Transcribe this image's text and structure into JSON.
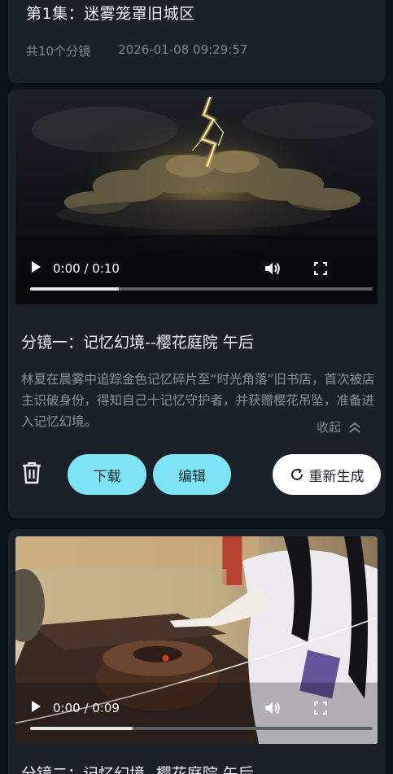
{
  "episode": {
    "title": "第1集：迷雾笼罩旧城区",
    "shot_count": "共10个分镜",
    "datetime": "2026-01-08  09:29:57"
  },
  "shots": [
    {
      "title": "分镜一：记忆幻境--樱花庭院 午后",
      "description": "林夏在晨雾中追踪金色记忆碎片至“时光角落”旧书店，首次被店主识破身份，得知自己十记忆守护者，并获赠樱花吊坠，准备进入记忆幻境。",
      "collapse_label": "收起",
      "video": {
        "time": "0:00 / 0:10",
        "progress": 0.26
      },
      "buttons": {
        "download": "下载",
        "edit": "编辑",
        "regenerate": "重新生成"
      }
    },
    {
      "title": "分镜二：记忆幻境--樱花庭院 午后",
      "video": {
        "time": "0:00 / 0:09",
        "progress": 0.3
      }
    }
  ],
  "icons": {
    "play": "play-icon",
    "volume": "volume-icon",
    "fullscreen": "fullscreen-icon",
    "delete": "trash-icon",
    "collapse": "chevron-up-icon",
    "refresh": "refresh-icon"
  },
  "colors": {
    "background": "#0c1219",
    "card": "#1b2128",
    "accent": "#7ee3f5",
    "muted_text": "#8a939d"
  }
}
